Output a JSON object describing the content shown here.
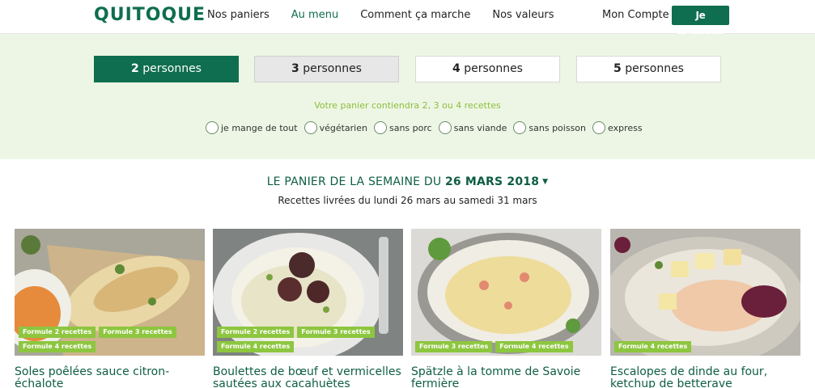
{
  "header": {
    "logo": "QUITOQUE",
    "nav": [
      "Nos paniers",
      "Au menu",
      "Comment ça marche",
      "Nos valeurs"
    ],
    "account": "Mon Compte",
    "signup": "Je m'inscris"
  },
  "persons": [
    {
      "n": "2",
      "label": "personnes"
    },
    {
      "n": "3",
      "label": "personnes"
    },
    {
      "n": "4",
      "label": "personnes"
    },
    {
      "n": "5",
      "label": "personnes"
    }
  ],
  "info": "Votre panier contiendra 2, 3 ou 4 recettes",
  "diets": [
    "je mange de tout",
    "végétarien",
    "sans porc",
    "sans viande",
    "sans poisson",
    "express"
  ],
  "week": {
    "prefix": "LE PANIER DE LA SEMAINE DU",
    "date": "26 MARS 2018",
    "subtitle": "Recettes livrées du lundi 26 mars au samedi 31 mars"
  },
  "recipes": [
    {
      "title": "Soles poêlées sauce citron-échalote",
      "tags": [
        "Formule 2 recettes",
        "Formule 3 recettes",
        "Formule 4 recettes"
      ]
    },
    {
      "title": "Boulettes de bœuf et vermicelles sautées aux cacahuètes",
      "tags": [
        "Formule 2 recettes",
        "Formule 3 recettes",
        "Formule 4 recettes"
      ]
    },
    {
      "title": "Spätzle à la tomme de Savoie fermière",
      "tags": [
        "Formule 3 recettes",
        "Formule 4 recettes"
      ]
    },
    {
      "title": "Escalopes de dinde au four, ketchup de betterave",
      "tags": [
        "Formule 4 recettes"
      ]
    }
  ],
  "colors": {
    "brand": "#0e6e4f",
    "accent": "#8dc63f",
    "band": "#edf6e5"
  }
}
